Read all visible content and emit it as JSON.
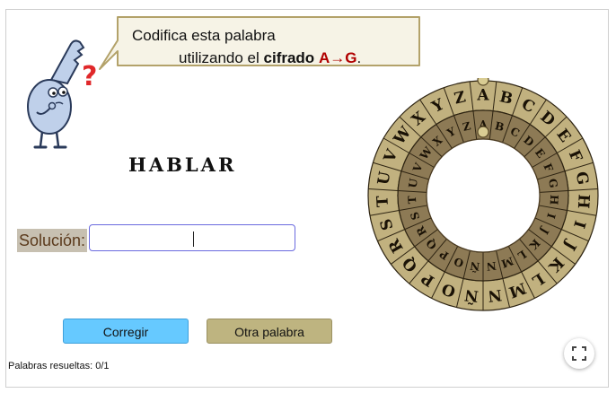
{
  "prompt": {
    "line1": "Codifica esta palabra",
    "line2_prefix": "utilizando el ",
    "line2_bold": "cifrado",
    "line2_code": "A→G",
    "line2_end": "."
  },
  "word": "HABLAR",
  "solution": {
    "label": "Solución:",
    "value": ""
  },
  "buttons": {
    "check": "Corregir",
    "next": "Otra palabra"
  },
  "status": {
    "solved_text": "Palabras resueltas: 0/1"
  },
  "cipher_wheel": {
    "outer_letters": [
      "A",
      "B",
      "C",
      "D",
      "E",
      "F",
      "G",
      "H",
      "I",
      "J",
      "K",
      "L",
      "M",
      "N",
      "Ñ",
      "O",
      "P",
      "Q",
      "R",
      "S",
      "T",
      "U",
      "V",
      "W",
      "X",
      "Y",
      "Z"
    ],
    "inner_letters": [
      "A",
      "B",
      "C",
      "D",
      "E",
      "F",
      "G",
      "H",
      "I",
      "J",
      "K",
      "L",
      "M",
      "N",
      "Ñ",
      "O",
      "P",
      "Q",
      "R",
      "S",
      "T",
      "U",
      "V",
      "W",
      "X",
      "Y",
      "Z"
    ],
    "shift": 0
  },
  "colors": {
    "outer_ring": "#c1b17f",
    "inner_ring": "#8d7a55",
    "check_button": "#66c9ff",
    "next_button": "#beb480"
  },
  "icons": {
    "mascot": "key-character-thinking",
    "fullscreen": "fullscreen-icon"
  }
}
